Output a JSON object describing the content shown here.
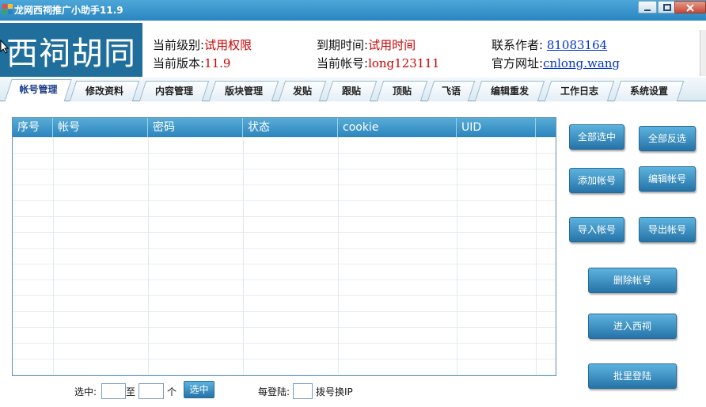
{
  "window": {
    "title": "龙网西祠推广小助手11.9"
  },
  "header": {
    "logo_text": "西祠胡同",
    "level_label": "当前级别:",
    "level_value": "试用权限",
    "expire_label": "到期时间:",
    "expire_value": "试用时间",
    "contact_label": "联系作者:",
    "contact_value": "81083164",
    "version_label": "当前版本:",
    "version_value": "11.9",
    "account_label": "当前帐号:",
    "account_value": "long123111",
    "site_label": "官方网址:",
    "site_value": "cnlong.wang"
  },
  "tabs": [
    {
      "label": "帐号管理",
      "active": true
    },
    {
      "label": "修改资料"
    },
    {
      "label": "内容管理"
    },
    {
      "label": "版块管理"
    },
    {
      "label": "发贴"
    },
    {
      "label": "跟贴"
    },
    {
      "label": "顶贴"
    },
    {
      "label": "飞语"
    },
    {
      "label": "编辑重发"
    },
    {
      "label": "工作日志"
    },
    {
      "label": "系统设置"
    }
  ],
  "table": {
    "columns": [
      "序号",
      "帐号",
      "密码",
      "状态",
      "cookie",
      "UID"
    ],
    "rows": []
  },
  "buttons": {
    "select_all": "全部选中",
    "invert_all": "全部反选",
    "add_account": "添加帐号",
    "edit_account": "编辑帐号",
    "import_account": "导入帐号",
    "export_account": "导出帐号",
    "delete_account": "删除帐号",
    "enter_xici": "进入西祠",
    "batch_login": "批里登陆"
  },
  "footer": {
    "select_label": "选中:",
    "to_label": "至",
    "unit_label": "个",
    "select_button": "选中",
    "per_login_label": "每登陆:",
    "dial_label": "拨号换IP",
    "from_value": "",
    "to_value": "",
    "per_login_value": ""
  }
}
